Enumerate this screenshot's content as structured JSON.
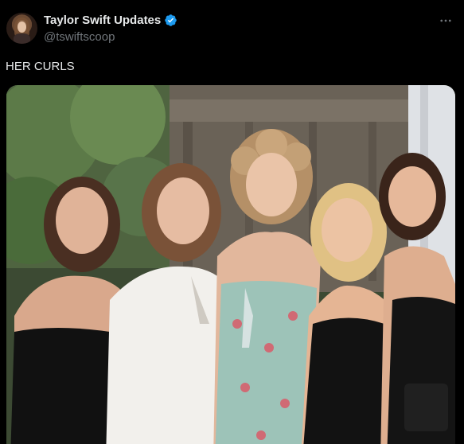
{
  "post": {
    "author": {
      "display_name": "Taylor Swift Updates",
      "handle": "@tswiftscoop",
      "verified": true,
      "avatar_icon": "profile-avatar"
    },
    "text": "HER CURLS",
    "more_icon": "more-horizontal-icon",
    "media": {
      "type": "photo"
    }
  },
  "colors": {
    "background": "#000000",
    "primary_text": "#e7e9ea",
    "secondary_text": "#71767b",
    "verified_blue": "#1d9bf0"
  }
}
